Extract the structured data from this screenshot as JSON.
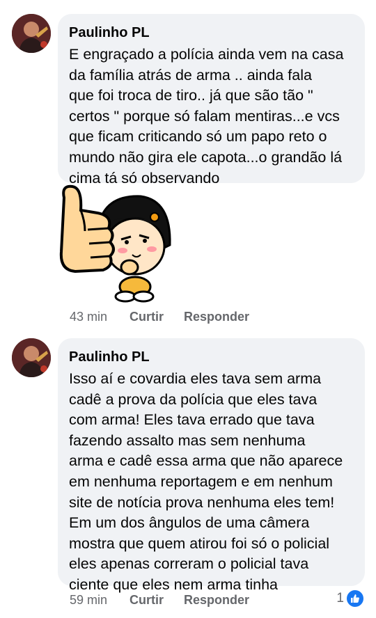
{
  "comments": [
    {
      "author": "Paulinho PL",
      "text": "E engraçado a polícia ainda vem na casa\nda família  atrás de arma .. ainda fala\nque  foi troca de tiro.. já que são tão \"\ncertos \" porque só falam mentiras...e vcs\nque ficam criticando  só um papo reto o\nmundo não gira ele capota...o grandão lá\ncima tá só observando",
      "time": "43 min",
      "like_label": "Curtir",
      "reply_label": "Responder"
    },
    {
      "author": "Paulinho PL",
      "text": "Isso aí e covardia eles tava sem arma\ncadê a prova da polícia que eles tava\ncom arma! Eles tava errado que tava\nfazendo assalto mas sem nenhuma\narma e cadê essa arma que não aparece\nem nenhuma reportagem e em nenhum\nsite de notícia prova nenhuma eles tem!\nEm um dos ângulos de uma câmera\nmostra que quem atirou foi só o policial\neles apenas correram o policial tava\nciente que eles nem arma tinha",
      "time": "59 min",
      "like_label": "Curtir",
      "reply_label": "Responder",
      "reaction_count": "1"
    }
  ],
  "colors": {
    "bubble": "#f0f2f5",
    "meta": "#65676b",
    "like_blue": "#1877f2"
  },
  "sticker": {
    "icon": "thumbs-up-girl-sticker"
  }
}
